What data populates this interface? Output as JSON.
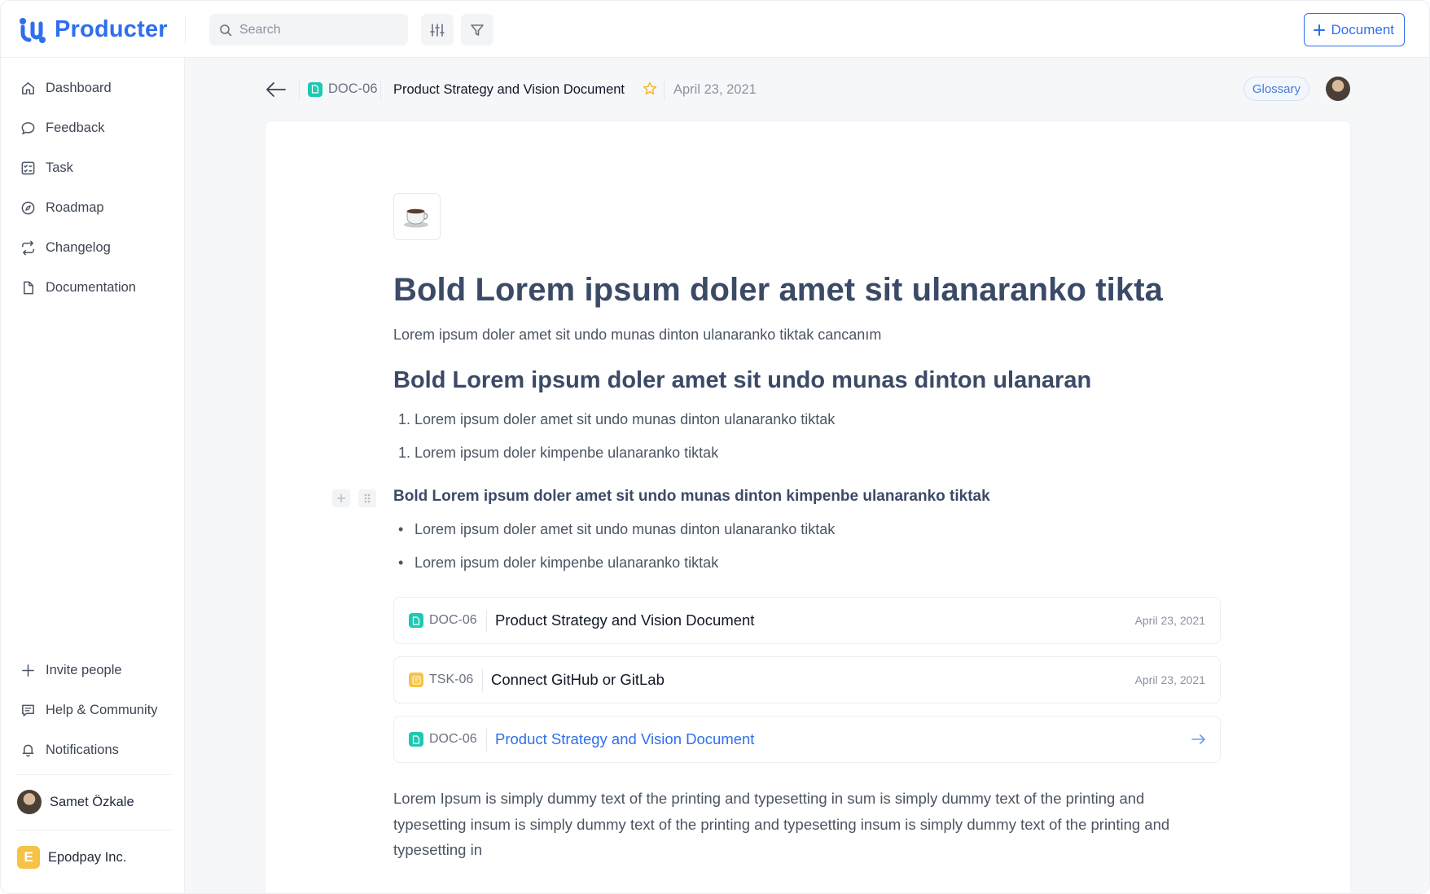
{
  "app": {
    "name": "Producter",
    "brand_color": "#2f6fec"
  },
  "topbar": {
    "search_placeholder": "Search",
    "document_button_label": "Document",
    "icons": [
      "search-icon",
      "sliders-icon",
      "filter-icon",
      "plus-icon"
    ]
  },
  "sidebar": {
    "items": [
      {
        "label": "Dashboard",
        "icon": "home-icon"
      },
      {
        "label": "Feedback",
        "icon": "chat-bubble-icon"
      },
      {
        "label": "Task",
        "icon": "checklist-icon"
      },
      {
        "label": "Roadmap",
        "icon": "compass-icon"
      },
      {
        "label": "Changelog",
        "icon": "refresh-icon"
      },
      {
        "label": "Documentation",
        "icon": "file-icon"
      }
    ],
    "bottom_items": [
      {
        "label": "Invite people",
        "icon": "plus-icon"
      },
      {
        "label": "Help & Community",
        "icon": "message-icon"
      },
      {
        "label": "Notifications",
        "icon": "bell-icon"
      }
    ],
    "user_name": "Samet Özkale",
    "org": {
      "initial": "E",
      "name": "Epodpay Inc.",
      "color": "#f6c344"
    }
  },
  "doc_header": {
    "code": "DOC-06",
    "title": "Product Strategy and Vision Document",
    "date": "April 23, 2021",
    "tag": "Glossary"
  },
  "content": {
    "emoji": "☕",
    "h1": "Bold Lorem ipsum doler amet sit ulanaranko tikta",
    "subtitle": "Lorem ipsum doler amet sit undo munas dinton ulanaranko tiktak cancanım",
    "h2": "Bold Lorem ipsum doler amet sit undo munas dinton ulanaran",
    "ordered_list": [
      {
        "marker": "1.",
        "text": "Lorem ipsum doler amet sit undo munas dinton ulanaranko tiktak"
      },
      {
        "marker": "1.",
        "text": "Lorem ipsum doler kimpenbe ulanaranko tiktak"
      }
    ],
    "h3": "Bold Lorem ipsum doler amet sit undo munas dinton kimpenbe ulanaranko tiktak",
    "bullet_list": [
      {
        "marker": "•",
        "text": "Lorem ipsum doler amet sit undo munas dinton ulanaranko tiktak"
      },
      {
        "marker": "•",
        "text": "Lorem ipsum doler kimpenbe ulanaranko tiktak"
      }
    ],
    "references": [
      {
        "code": "DOC-06",
        "title": "Product Strategy and Vision Document",
        "date": "April 23, 2021",
        "kind": "doc"
      },
      {
        "code": "TSK-06",
        "title": "Connect GitHub or GitLab",
        "date": "April 23, 2021",
        "kind": "task"
      },
      {
        "code": "DOC-06",
        "title": "Product Strategy and Vision Document",
        "kind": "doc-link"
      }
    ],
    "paragraph": "Lorem Ipsum is simply dummy text of the printing and typesetting in sum is simply dummy text of the printing and typesetting insum is simply dummy text of the printing and typesetting insum is simply dummy text of the printing and typesetting in"
  }
}
